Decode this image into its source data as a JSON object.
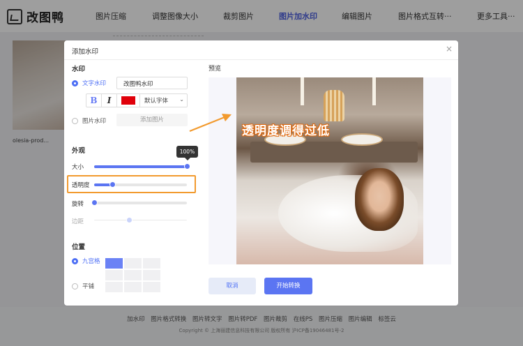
{
  "logo": {
    "text": "改图鸭"
  },
  "nav": [
    {
      "label": "图片压缩"
    },
    {
      "label": "调整图像大小"
    },
    {
      "label": "裁剪图片"
    },
    {
      "label": "图片加水印"
    },
    {
      "label": "编辑图片"
    },
    {
      "label": "图片格式互转···"
    },
    {
      "label": "更多工具···"
    }
  ],
  "background": {
    "file_name": "olesia-prod..."
  },
  "footer": {
    "links": [
      "加水印",
      "图片格式转换",
      "图片转文字",
      "图片转PDF",
      "图片裁剪",
      "在线PS",
      "图片压缩",
      "图片编辑",
      "标签云"
    ],
    "copyright": "Copyright © 上海丽建信息科技有限公司 版权所有 沪ICP备19046481号-2"
  },
  "modal": {
    "title": "添加水印",
    "close": "×",
    "watermark_section": "水印",
    "text_watermark_label": "文字水印",
    "text_watermark_value": "改图鸭水印",
    "bold_label": "B",
    "italic_label": "I",
    "font_color": "#e0000a",
    "font_family": "默认字体",
    "image_watermark_label": "图片水印",
    "add_image_label": "添加图片",
    "appearance_section": "外观",
    "size": {
      "label": "大小",
      "value": 100,
      "tooltip": "100%"
    },
    "opacity": {
      "label": "透明度",
      "value": 20
    },
    "rotation": {
      "label": "旋转",
      "value": 0
    },
    "margin": {
      "label": "边距",
      "value": 38
    },
    "position_section": "位置",
    "nine_grid_label": "九宫格",
    "tile_label": "平铺",
    "preview_label": "预览",
    "cancel_label": "取消",
    "start_label": "开始转换"
  },
  "annotation": {
    "text": "透明度调得过低",
    "color": "#f29a2e"
  },
  "colors": {
    "accent": "#5b75f2",
    "highlight": "#f29a2e"
  }
}
